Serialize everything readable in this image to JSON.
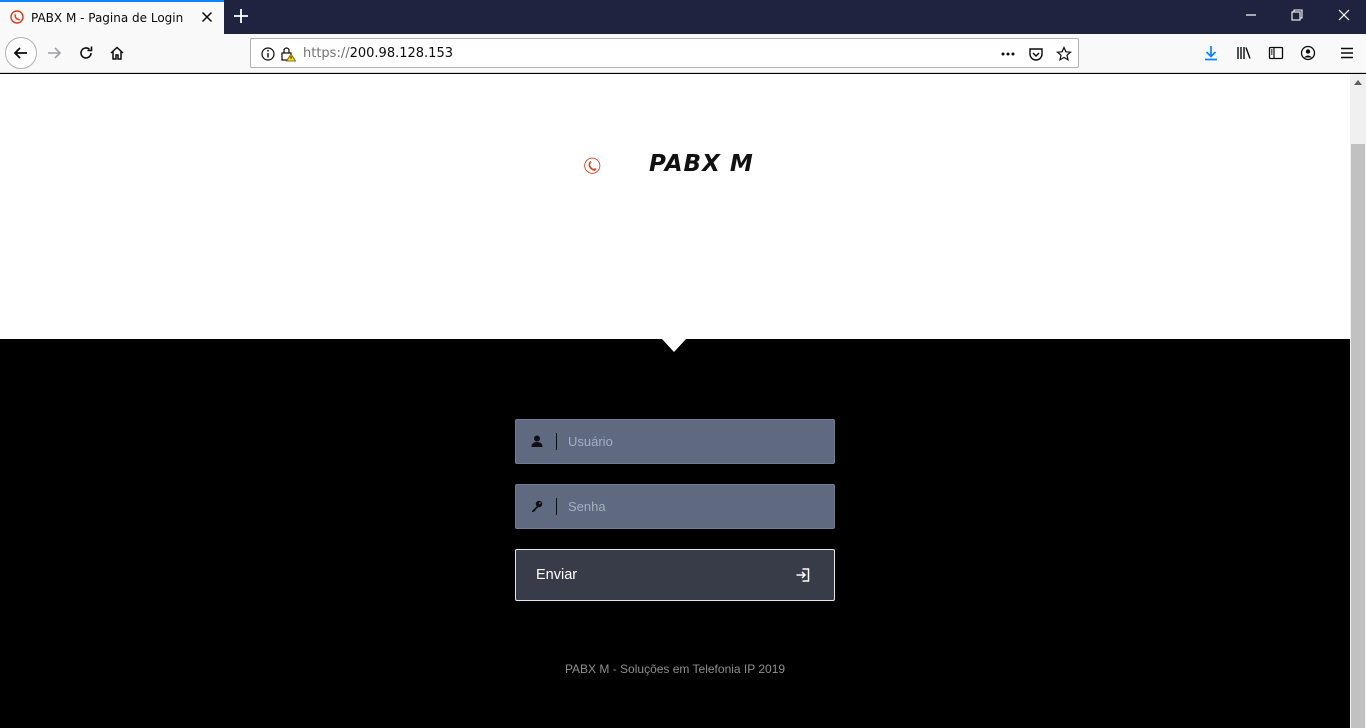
{
  "browser": {
    "tab_title": "PABX M - Pagina de Login",
    "url_scheme": "https://",
    "url_host": "200.98.128.153"
  },
  "page": {
    "brand_name": "PABX M",
    "username_placeholder": "Usuário",
    "password_placeholder": "Senha",
    "submit_label": "Enviar",
    "footer_text": "PABX M - Soluções em Telefonia IP 2019"
  },
  "colors": {
    "accent_red": "#d63a1b",
    "field_bg": "#5f6980",
    "button_bg": "#383c49",
    "tab_active_border": "#0a84ff"
  },
  "icons": {
    "username": "user-icon",
    "password": "key-icon",
    "submit": "sign-in-icon"
  }
}
